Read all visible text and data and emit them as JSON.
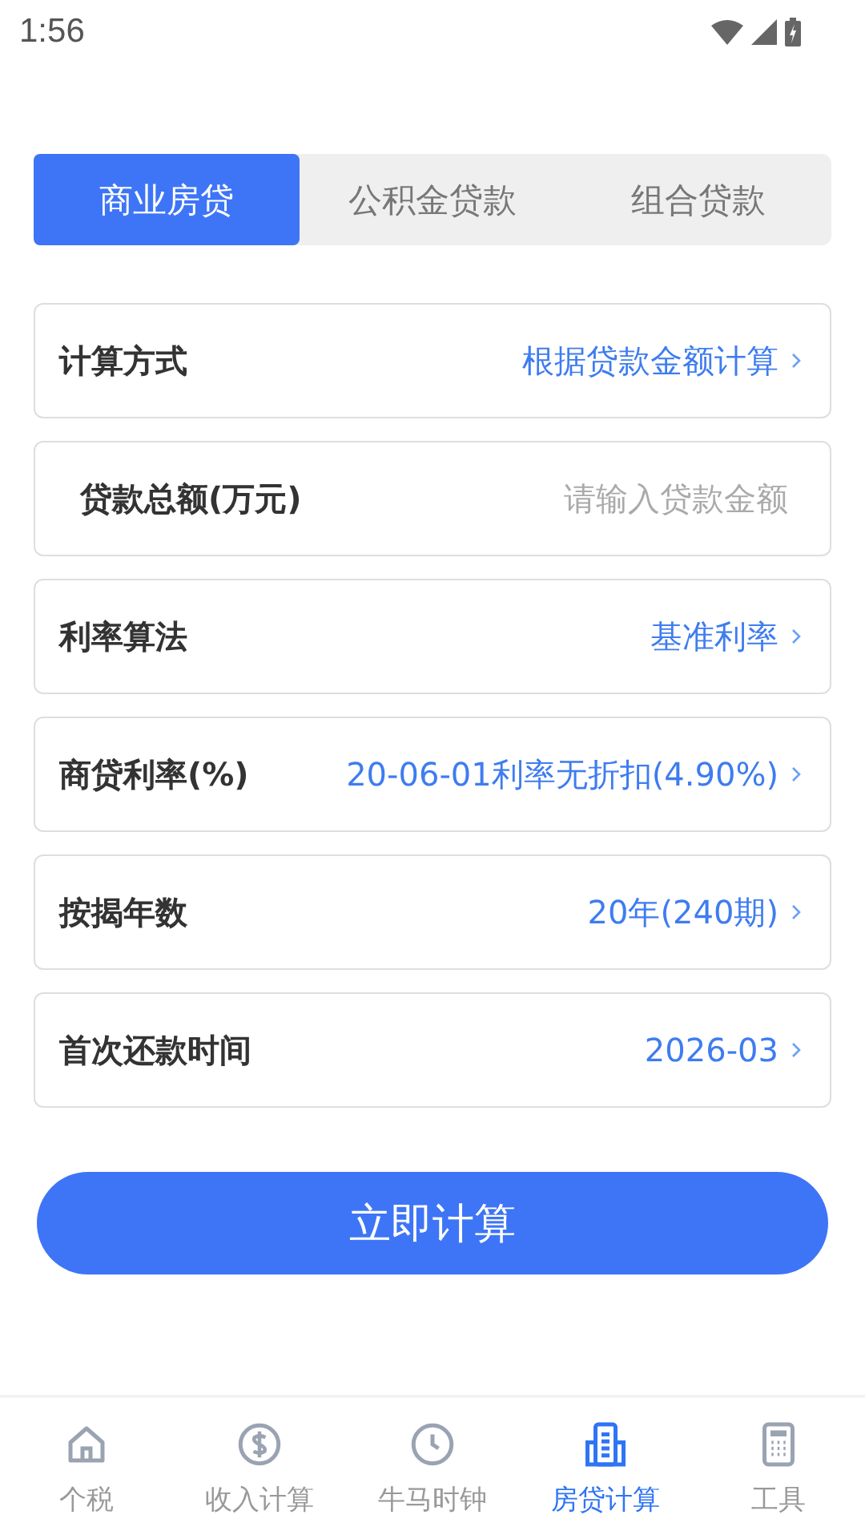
{
  "status_bar": {
    "time": "1:56"
  },
  "tabs": [
    {
      "label": "商业房贷",
      "selected": true
    },
    {
      "label": "公积金贷款",
      "selected": false
    },
    {
      "label": "组合贷款",
      "selected": false
    }
  ],
  "rows": [
    {
      "kind": "select",
      "label": "计算方式",
      "value": "根据贷款金额计算"
    },
    {
      "kind": "input",
      "label": "贷款总额(万元)",
      "placeholder": "请输入贷款金额"
    },
    {
      "kind": "select",
      "label": "利率算法",
      "value": "基准利率"
    },
    {
      "kind": "select",
      "label": "商贷利率(%)",
      "value": "20-06-01利率无折扣(4.90%)"
    },
    {
      "kind": "select",
      "label": "按揭年数",
      "value": "20年(240期)"
    },
    {
      "kind": "select",
      "label": "首次还款时间",
      "value": "2026-03"
    }
  ],
  "calculate_button": "立即计算",
  "bottom_nav": [
    {
      "label": "个税",
      "selected": false
    },
    {
      "label": "收入计算",
      "selected": false
    },
    {
      "label": "牛马时钟",
      "selected": false
    },
    {
      "label": "房贷计算",
      "selected": true
    },
    {
      "label": "工具",
      "selected": false
    }
  ]
}
